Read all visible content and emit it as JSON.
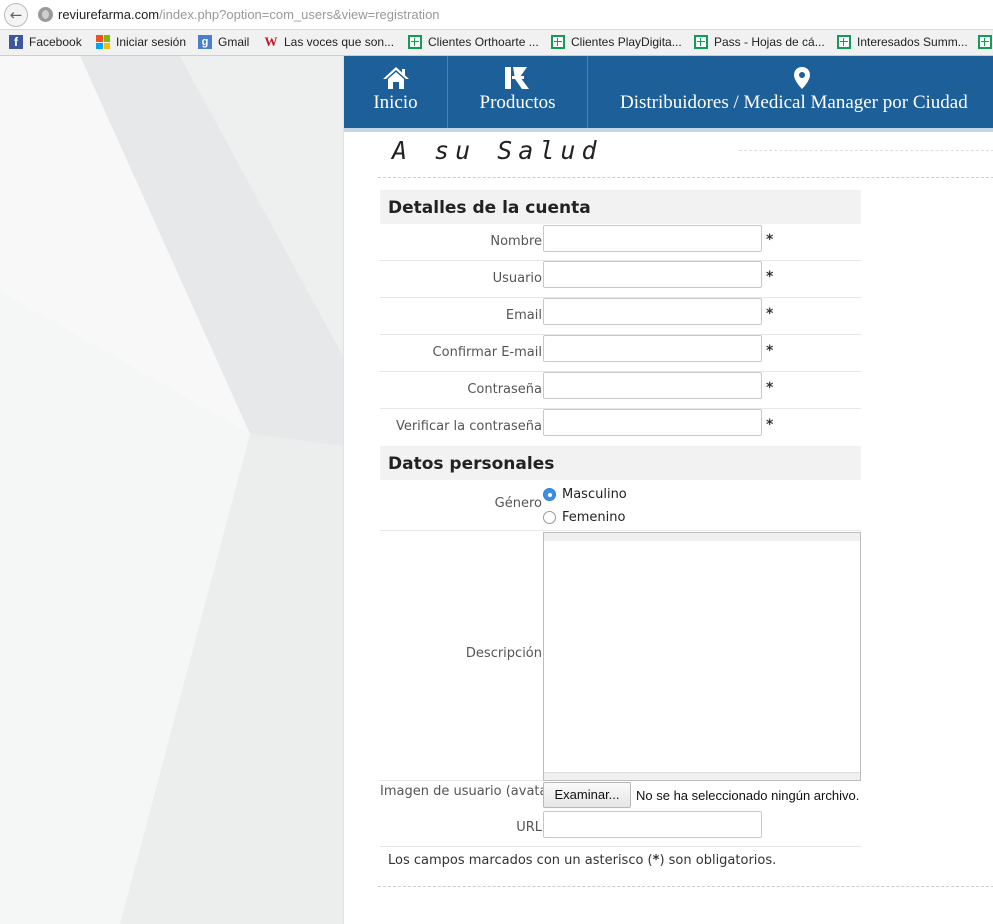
{
  "browser": {
    "url_host": "reviurefarma.com",
    "url_path": "/index.php?option=com_users&view=registration"
  },
  "bookmarks": [
    {
      "label": "Facebook",
      "icon": "facebook-icon"
    },
    {
      "label": "Iniciar sesión",
      "icon": "microsoft-icon"
    },
    {
      "label": "Gmail",
      "icon": "google-icon"
    },
    {
      "label": "Las voces que son...",
      "icon": "w-icon"
    },
    {
      "label": "Clientes Orthoarte ...",
      "icon": "sheets-icon"
    },
    {
      "label": "Clientes PlayDigita...",
      "icon": "sheets-icon"
    },
    {
      "label": "Pass - Hojas de cá...",
      "icon": "sheets-icon"
    },
    {
      "label": "Interesados Summ...",
      "icon": "sheets-icon"
    }
  ],
  "nav": {
    "items": [
      {
        "label": "Inicio",
        "icon": "home-icon"
      },
      {
        "label": "Productos",
        "icon": "logo-icon"
      },
      {
        "label": "Distribuidores / Medical Manager por Ciudad",
        "icon": "map-pin-icon"
      }
    ]
  },
  "tagline": "A su Salud",
  "form": {
    "account_section": "Detalles de la cuenta",
    "account_fields": [
      {
        "label": "Nombre",
        "value": "",
        "required": "*"
      },
      {
        "label": "Usuario",
        "value": "",
        "required": "*"
      },
      {
        "label": "Email",
        "value": "",
        "required": "*"
      },
      {
        "label": "Confirmar E-mail",
        "value": "",
        "required": "*"
      },
      {
        "label": "Contraseña",
        "value": "",
        "required": "*"
      },
      {
        "label": "Verificar la contraseña",
        "value": "",
        "required": "*"
      }
    ],
    "personal_section": "Datos personales",
    "gender_label": "Género",
    "gender_options": [
      {
        "label": "Masculino",
        "selected": true
      },
      {
        "label": "Femenino",
        "selected": false
      }
    ],
    "description_label": "Descripción",
    "avatar_label": "Imagen de usuario (avatar)",
    "browse_button": "Examinar...",
    "no_file_text": "No se ha seleccionado ningún archivo.",
    "url_label": "URL",
    "required_note_before": "Los campos marcados con un asterisco (",
    "required_note_mark": "*",
    "required_note_after": ") son obligatorios."
  },
  "colors": {
    "nav_background": "#1d5f98",
    "radio_selected": "#3b8fe8"
  }
}
